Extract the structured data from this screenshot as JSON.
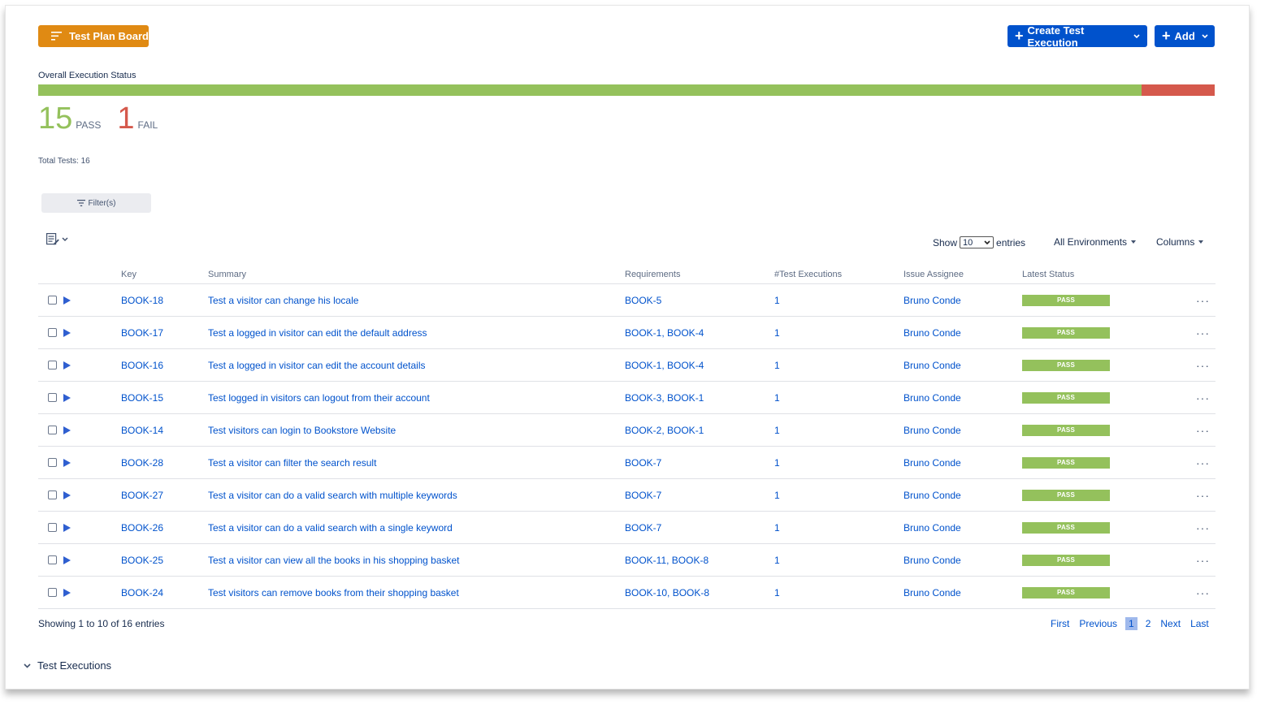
{
  "buttons": {
    "test_plan_board": "Test Plan Board",
    "create_test_execution": "Create Test Execution",
    "add": "Add"
  },
  "status": {
    "label": "Overall Execution Status",
    "pass_count": "15",
    "pass_label": "PASS",
    "fail_count": "1",
    "fail_label": "FAIL",
    "pass_fraction": 0.9375,
    "fail_fraction": 0.0625,
    "total_text": "Total Tests: 16"
  },
  "filter": {
    "label": "Filter(s)"
  },
  "controls": {
    "show_label": "Show",
    "show_value": "10",
    "entries_label": "entries",
    "environments": "All Environments",
    "columns": "Columns"
  },
  "table": {
    "headers": {
      "key": "Key",
      "summary": "Summary",
      "requirements": "Requirements",
      "executions": "#Test Executions",
      "assignee": "Issue Assignee",
      "status": "Latest Status"
    },
    "rows": [
      {
        "key": "BOOK-18",
        "summary": "Test a visitor can change his locale",
        "requirements": "BOOK-5",
        "executions": "1",
        "assignee": "Bruno Conde",
        "status": "PASS"
      },
      {
        "key": "BOOK-17",
        "summary": "Test a logged in visitor can edit the default address",
        "requirements": "BOOK-1, BOOK-4",
        "executions": "1",
        "assignee": "Bruno Conde",
        "status": "PASS"
      },
      {
        "key": "BOOK-16",
        "summary": "Test a logged in visitor can edit the account details",
        "requirements": "BOOK-1, BOOK-4",
        "executions": "1",
        "assignee": "Bruno Conde",
        "status": "PASS"
      },
      {
        "key": "BOOK-15",
        "summary": "Test logged in visitors can logout from their account",
        "requirements": "BOOK-3, BOOK-1",
        "executions": "1",
        "assignee": "Bruno Conde",
        "status": "PASS"
      },
      {
        "key": "BOOK-14",
        "summary": "Test visitors can login to Bookstore Website",
        "requirements": "BOOK-2, BOOK-1",
        "executions": "1",
        "assignee": "Bruno Conde",
        "status": "PASS"
      },
      {
        "key": "BOOK-28",
        "summary": "Test a visitor can filter the search result",
        "requirements": "BOOK-7",
        "executions": "1",
        "assignee": "Bruno Conde",
        "status": "PASS"
      },
      {
        "key": "BOOK-27",
        "summary": "Test a visitor can do a valid search with multiple keywords",
        "requirements": "BOOK-7",
        "executions": "1",
        "assignee": "Bruno Conde",
        "status": "PASS"
      },
      {
        "key": "BOOK-26",
        "summary": "Test a visitor can do a valid search with a single keyword",
        "requirements": "BOOK-7",
        "executions": "1",
        "assignee": "Bruno Conde",
        "status": "PASS"
      },
      {
        "key": "BOOK-25",
        "summary": "Test a visitor can view all the books in his shopping basket",
        "requirements": "BOOK-11, BOOK-8",
        "executions": "1",
        "assignee": "Bruno Conde",
        "status": "PASS"
      },
      {
        "key": "BOOK-24",
        "summary": "Test visitors can remove books from their shopping basket",
        "requirements": "BOOK-10, BOOK-8",
        "executions": "1",
        "assignee": "Bruno Conde",
        "status": "PASS"
      }
    ],
    "more_glyph": "···"
  },
  "pagination": {
    "showing_text": "Showing 1 to 10 of 16 entries",
    "first": "First",
    "previous": "Previous",
    "pages": [
      "1",
      "2"
    ],
    "next": "Next",
    "last": "Last"
  },
  "sections": {
    "test_executions": "Test Executions"
  },
  "colors": {
    "pass": "#94c15c",
    "fail": "#d5594c",
    "primary": "#0052cc",
    "board_button": "#e08a13"
  }
}
